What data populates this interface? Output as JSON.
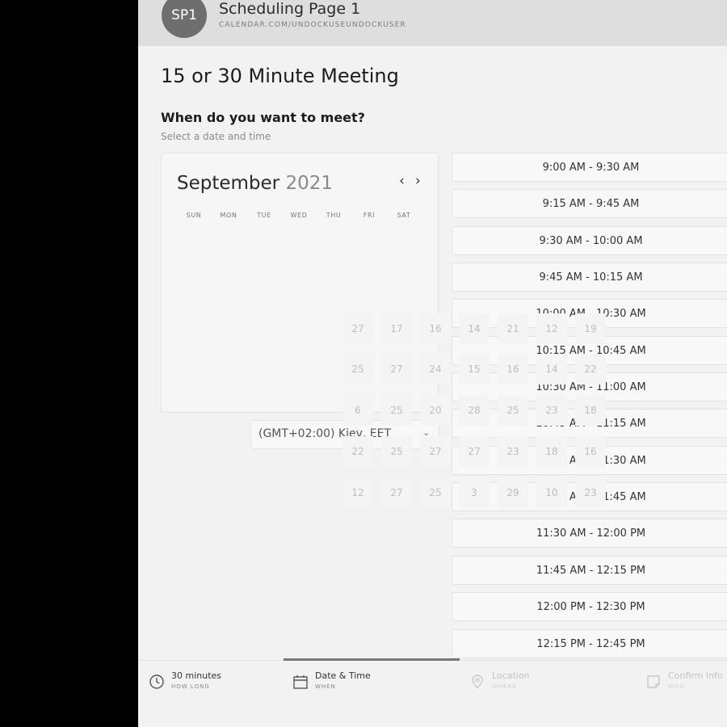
{
  "header": {
    "avatar_initials": "SP1",
    "title": "Scheduling Page 1",
    "url": "CALENDAR.COM/UNDOCKUSEUNDOCKUSER"
  },
  "meeting": {
    "title": "15 or 30 Minute Meeting",
    "question": "When do you want to meet?",
    "subtitle": "Select a date and time"
  },
  "calendar": {
    "month": "September",
    "year": "2021",
    "prev_icon": "chevron-left-icon",
    "next_icon": "chevron-right-icon",
    "prev_glyph": "‹",
    "next_glyph": "›",
    "weekdays": [
      "SUN",
      "MON",
      "TUE",
      "WED",
      "THU",
      "FRI",
      "SAT"
    ]
  },
  "timezone": {
    "value": "(GMT+02:00) Kiev, EET",
    "chevron": "⌄"
  },
  "slots": [
    "9:00 AM - 9:30 AM",
    "9:15 AM - 9:45 AM",
    "9:30 AM - 10:00 AM",
    "9:45 AM - 10:15 AM",
    "10:00 AM - 10:30 AM",
    "10:15 AM - 10:45 AM",
    "10:30 AM - 11:00 AM",
    "10:45 AM - 11:15 AM",
    "11:00 AM - 11:30 AM",
    "11:15 AM - 11:45 AM",
    "11:30 AM - 12:00 PM",
    "11:45 AM - 12:15 PM",
    "12:00 PM - 12:30 PM",
    "12:15 PM - 12:45 PM"
  ],
  "scattered_cells": [
    [
      "27",
      "17",
      "16",
      "14",
      "21",
      "12",
      "19"
    ],
    [
      "25",
      "27",
      "24",
      "15",
      "16",
      "14",
      "22"
    ],
    [
      "6",
      "25",
      "20",
      "28",
      "25",
      "23",
      "18"
    ],
    [
      "22",
      "25",
      "27",
      "27",
      "23",
      "18",
      "16"
    ],
    [
      "12",
      "27",
      "25",
      "3",
      "29",
      "10",
      "23"
    ]
  ],
  "steps": [
    {
      "label": "30 minutes",
      "sub": "HOW LONG",
      "icon": "clock-icon"
    },
    {
      "label": "Date & Time",
      "sub": "WHEN",
      "icon": "calendar-icon"
    },
    {
      "label": "Location",
      "sub": "WHERE",
      "icon": "location-pin-icon"
    },
    {
      "label": "Confirm Info",
      "sub": "WHO",
      "icon": "note-icon"
    }
  ],
  "colors": {
    "page_bg": "#f2f2f2",
    "header_bg": "#dedede",
    "avatar_bg": "#6e6e6e",
    "active_step_bar": "#777777"
  }
}
